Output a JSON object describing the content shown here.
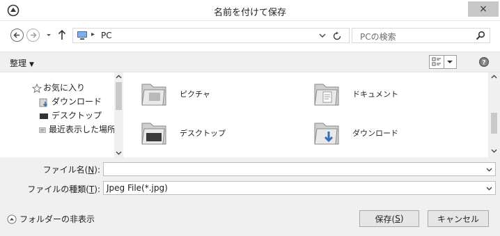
{
  "window": {
    "title": "名前を付けて保存",
    "close_symbol": "×"
  },
  "nav": {
    "back_icon": "back-arrow-icon",
    "forward_icon": "forward-arrow-icon",
    "up_icon": "up-arrow-icon",
    "address_sep": "▸",
    "address": "PC",
    "search_placeholder": "PCの検索"
  },
  "toolbar": {
    "organize_label": "整理",
    "organize_caret": "▼"
  },
  "sidebar": {
    "items": [
      {
        "label": "お気に入り",
        "icon": "star-icon"
      },
      {
        "label": "ダウンロード",
        "icon": "download-icon"
      },
      {
        "label": "デスクトップ",
        "icon": "desktop-icon"
      },
      {
        "label": "最近表示した場所",
        "icon": "recent-places-icon"
      }
    ]
  },
  "files": [
    {
      "label": "ピクチャ",
      "icon": "pictures-folder-icon"
    },
    {
      "label": "ドキュメント",
      "icon": "documents-folder-icon"
    },
    {
      "label": "デスクトップ",
      "icon": "desktop-folder-icon"
    },
    {
      "label": "ダウンロード",
      "icon": "downloads-folder-icon"
    }
  ],
  "form": {
    "filename_label_pre": "ファイル名(",
    "filename_label_key": "N",
    "filename_label_post": "):",
    "filename_value": "",
    "filetype_label_pre": "ファイルの種類(",
    "filetype_label_key": "T",
    "filetype_label_post": "):",
    "filetype_value": "Jpeg File(*.jpg)"
  },
  "footer": {
    "hide_folders": "フォルダーの非表示",
    "save_pre": "保存(",
    "save_key": "S",
    "save_post": ")",
    "cancel": "キャンセル"
  },
  "colors": {
    "title_bar": "#ffffff",
    "close_button": "#c7c7c7",
    "toolbar_bg": "#f0f0f0"
  }
}
